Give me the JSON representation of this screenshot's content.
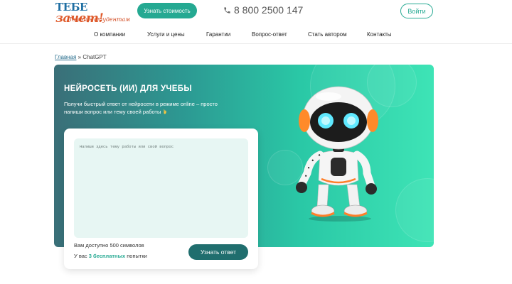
{
  "header": {
    "logo_top": "ТЕБЕ",
    "logo_script": "зачет!",
    "logo_tagline": "Помощь студентам",
    "cta_label": "Узнать стоимость",
    "phone": "8 800 2500 147",
    "login_label": "Войти"
  },
  "nav": {
    "items": [
      {
        "label": "О компании"
      },
      {
        "label": "Услуги и цены"
      },
      {
        "label": "Гарантии"
      },
      {
        "label": "Вопрос-ответ"
      },
      {
        "label": "Стать автором"
      },
      {
        "label": "Контакты"
      }
    ]
  },
  "breadcrumb": {
    "home": "Главная",
    "separator": " » ",
    "current": "ChatGPT"
  },
  "hero": {
    "title": "НЕЙРОСЕТЬ (ИИ) ДЛЯ УЧЕБЫ",
    "description": "Получи быстрый ответ от нейросети в режиме online – просто напиши вопрос или тему своей работы"
  },
  "form": {
    "placeholder": "Напиши здесь тему работы или свой вопрос",
    "limit_text": "Вам доступно 500 символов",
    "attempts_prefix": "У вас ",
    "attempts_highlight": "3 бесплатных",
    "attempts_suffix": " попытки",
    "submit_label": "Узнать ответ"
  },
  "colors": {
    "accent": "#25a992",
    "submit": "#206e6e",
    "logo_orange": "#e05a2a",
    "logo_blue": "#1f6fa3"
  }
}
